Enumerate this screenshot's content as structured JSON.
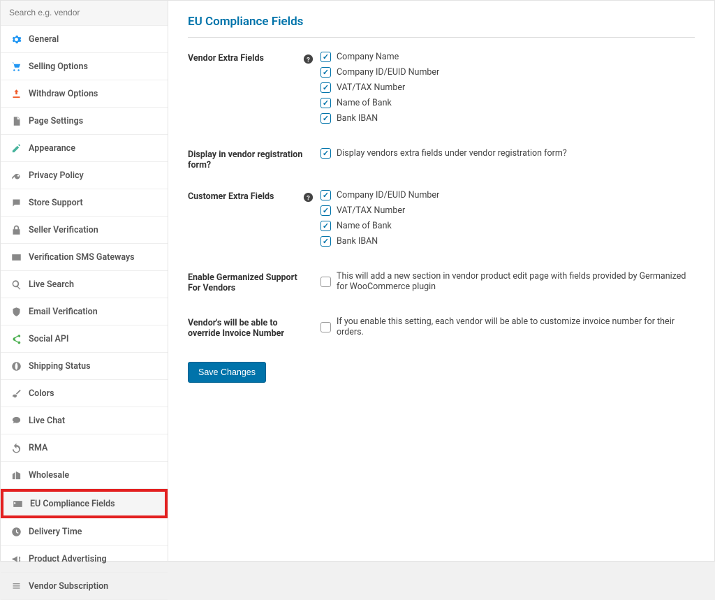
{
  "search": {
    "placeholder": "Search e.g. vendor"
  },
  "sidebar": {
    "items": [
      {
        "label": "General",
        "icon": "gear-icon",
        "color": "c-blue"
      },
      {
        "label": "Selling Options",
        "icon": "cart-icon",
        "color": "c-blue"
      },
      {
        "label": "Withdraw Options",
        "icon": "upload-icon",
        "color": "c-orange"
      },
      {
        "label": "Page Settings",
        "icon": "page-icon",
        "color": "c-gray"
      },
      {
        "label": "Appearance",
        "icon": "pencil-icon",
        "color": "c-teal"
      },
      {
        "label": "Privacy Policy",
        "icon": "key-icon",
        "color": "c-gray"
      },
      {
        "label": "Store Support",
        "icon": "chat-icon",
        "color": "c-gray"
      },
      {
        "label": "Seller Verification",
        "icon": "lock-icon",
        "color": "c-gray"
      },
      {
        "label": "Verification SMS Gateways",
        "icon": "mail-icon",
        "color": "c-gray"
      },
      {
        "label": "Live Search",
        "icon": "search-icon",
        "color": "c-gray"
      },
      {
        "label": "Email Verification",
        "icon": "shield-icon",
        "color": "c-gray"
      },
      {
        "label": "Social API",
        "icon": "share-icon",
        "color": "c-green"
      },
      {
        "label": "Shipping Status",
        "icon": "globe-icon",
        "color": "c-gray"
      },
      {
        "label": "Colors",
        "icon": "brush-icon",
        "color": "c-gray"
      },
      {
        "label": "Live Chat",
        "icon": "bubble-icon",
        "color": "c-gray"
      },
      {
        "label": "RMA",
        "icon": "undo-icon",
        "color": "c-gray"
      },
      {
        "label": "Wholesale",
        "icon": "building-icon",
        "color": "c-gray"
      },
      {
        "label": "EU Compliance Fields",
        "icon": "card-icon",
        "color": "c-gray",
        "active": true
      },
      {
        "label": "Delivery Time",
        "icon": "clock-icon",
        "color": "c-gray"
      },
      {
        "label": "Product Advertising",
        "icon": "megaphone-icon",
        "color": "c-gray"
      },
      {
        "label": "Vendor Subscription",
        "icon": "list-icon",
        "color": "c-gray"
      }
    ]
  },
  "page": {
    "title": "EU Compliance Fields"
  },
  "form": {
    "vendor_extra": {
      "label": "Vendor Extra Fields",
      "items": [
        {
          "label": "Company Name",
          "checked": true
        },
        {
          "label": "Company ID/EUID Number",
          "checked": true
        },
        {
          "label": "VAT/TAX Number",
          "checked": true
        },
        {
          "label": "Name of Bank",
          "checked": true
        },
        {
          "label": "Bank IBAN",
          "checked": true
        }
      ]
    },
    "display_registration": {
      "label": "Display in vendor registration form?",
      "option": "Display vendors extra fields under vendor registration form?",
      "checked": true
    },
    "customer_extra": {
      "label": "Customer Extra Fields",
      "items": [
        {
          "label": "Company ID/EUID Number",
          "checked": true
        },
        {
          "label": "VAT/TAX Number",
          "checked": true
        },
        {
          "label": "Name of Bank",
          "checked": true
        },
        {
          "label": "Bank IBAN",
          "checked": true
        }
      ]
    },
    "germanized": {
      "label": "Enable Germanized Support For Vendors",
      "option": "This will add a new section in vendor product edit page with fields provided by Germanized for WooCommerce plugin",
      "checked": false
    },
    "override_invoice": {
      "label": "Vendor's will be able to override Invoice Number",
      "option": "If you enable this setting, each vendor will be able to customize invoice number for their orders.",
      "checked": false
    },
    "save_button": "Save Changes"
  }
}
